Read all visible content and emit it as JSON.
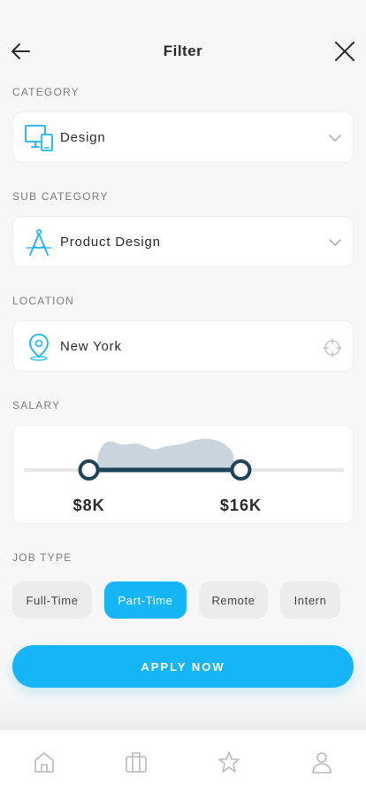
{
  "header": {
    "title": "Filter",
    "back_icon": "arrow-left-icon",
    "close_icon": "close-icon"
  },
  "category": {
    "label": "CATEGORY",
    "value": "Design",
    "icon": "devices-icon"
  },
  "sub_category": {
    "label": "SUB CATEGORY",
    "value": "Product Design",
    "icon": "drafting-compass-icon"
  },
  "location": {
    "label": "LOCATION",
    "value": "New York",
    "icon": "map-pin-icon",
    "action_icon": "locate-icon"
  },
  "salary": {
    "label": "SALARY",
    "min_label": "$8K",
    "max_label": "$16K",
    "range_fraction": [
      0.2,
      0.68
    ]
  },
  "job_type": {
    "label": "JOB TYPE",
    "options": [
      "Full-Time",
      "Part-Time",
      "Remote",
      "Intern"
    ],
    "selected": "Part-Time"
  },
  "apply_label": "APPLY NOW",
  "tabbar": {
    "items": [
      "home-icon",
      "briefcase-icon",
      "star-icon",
      "user-icon"
    ]
  },
  "colors": {
    "accent": "#16b5f5",
    "slider_dark": "#1d4459",
    "histogram": "#c8d5df"
  }
}
